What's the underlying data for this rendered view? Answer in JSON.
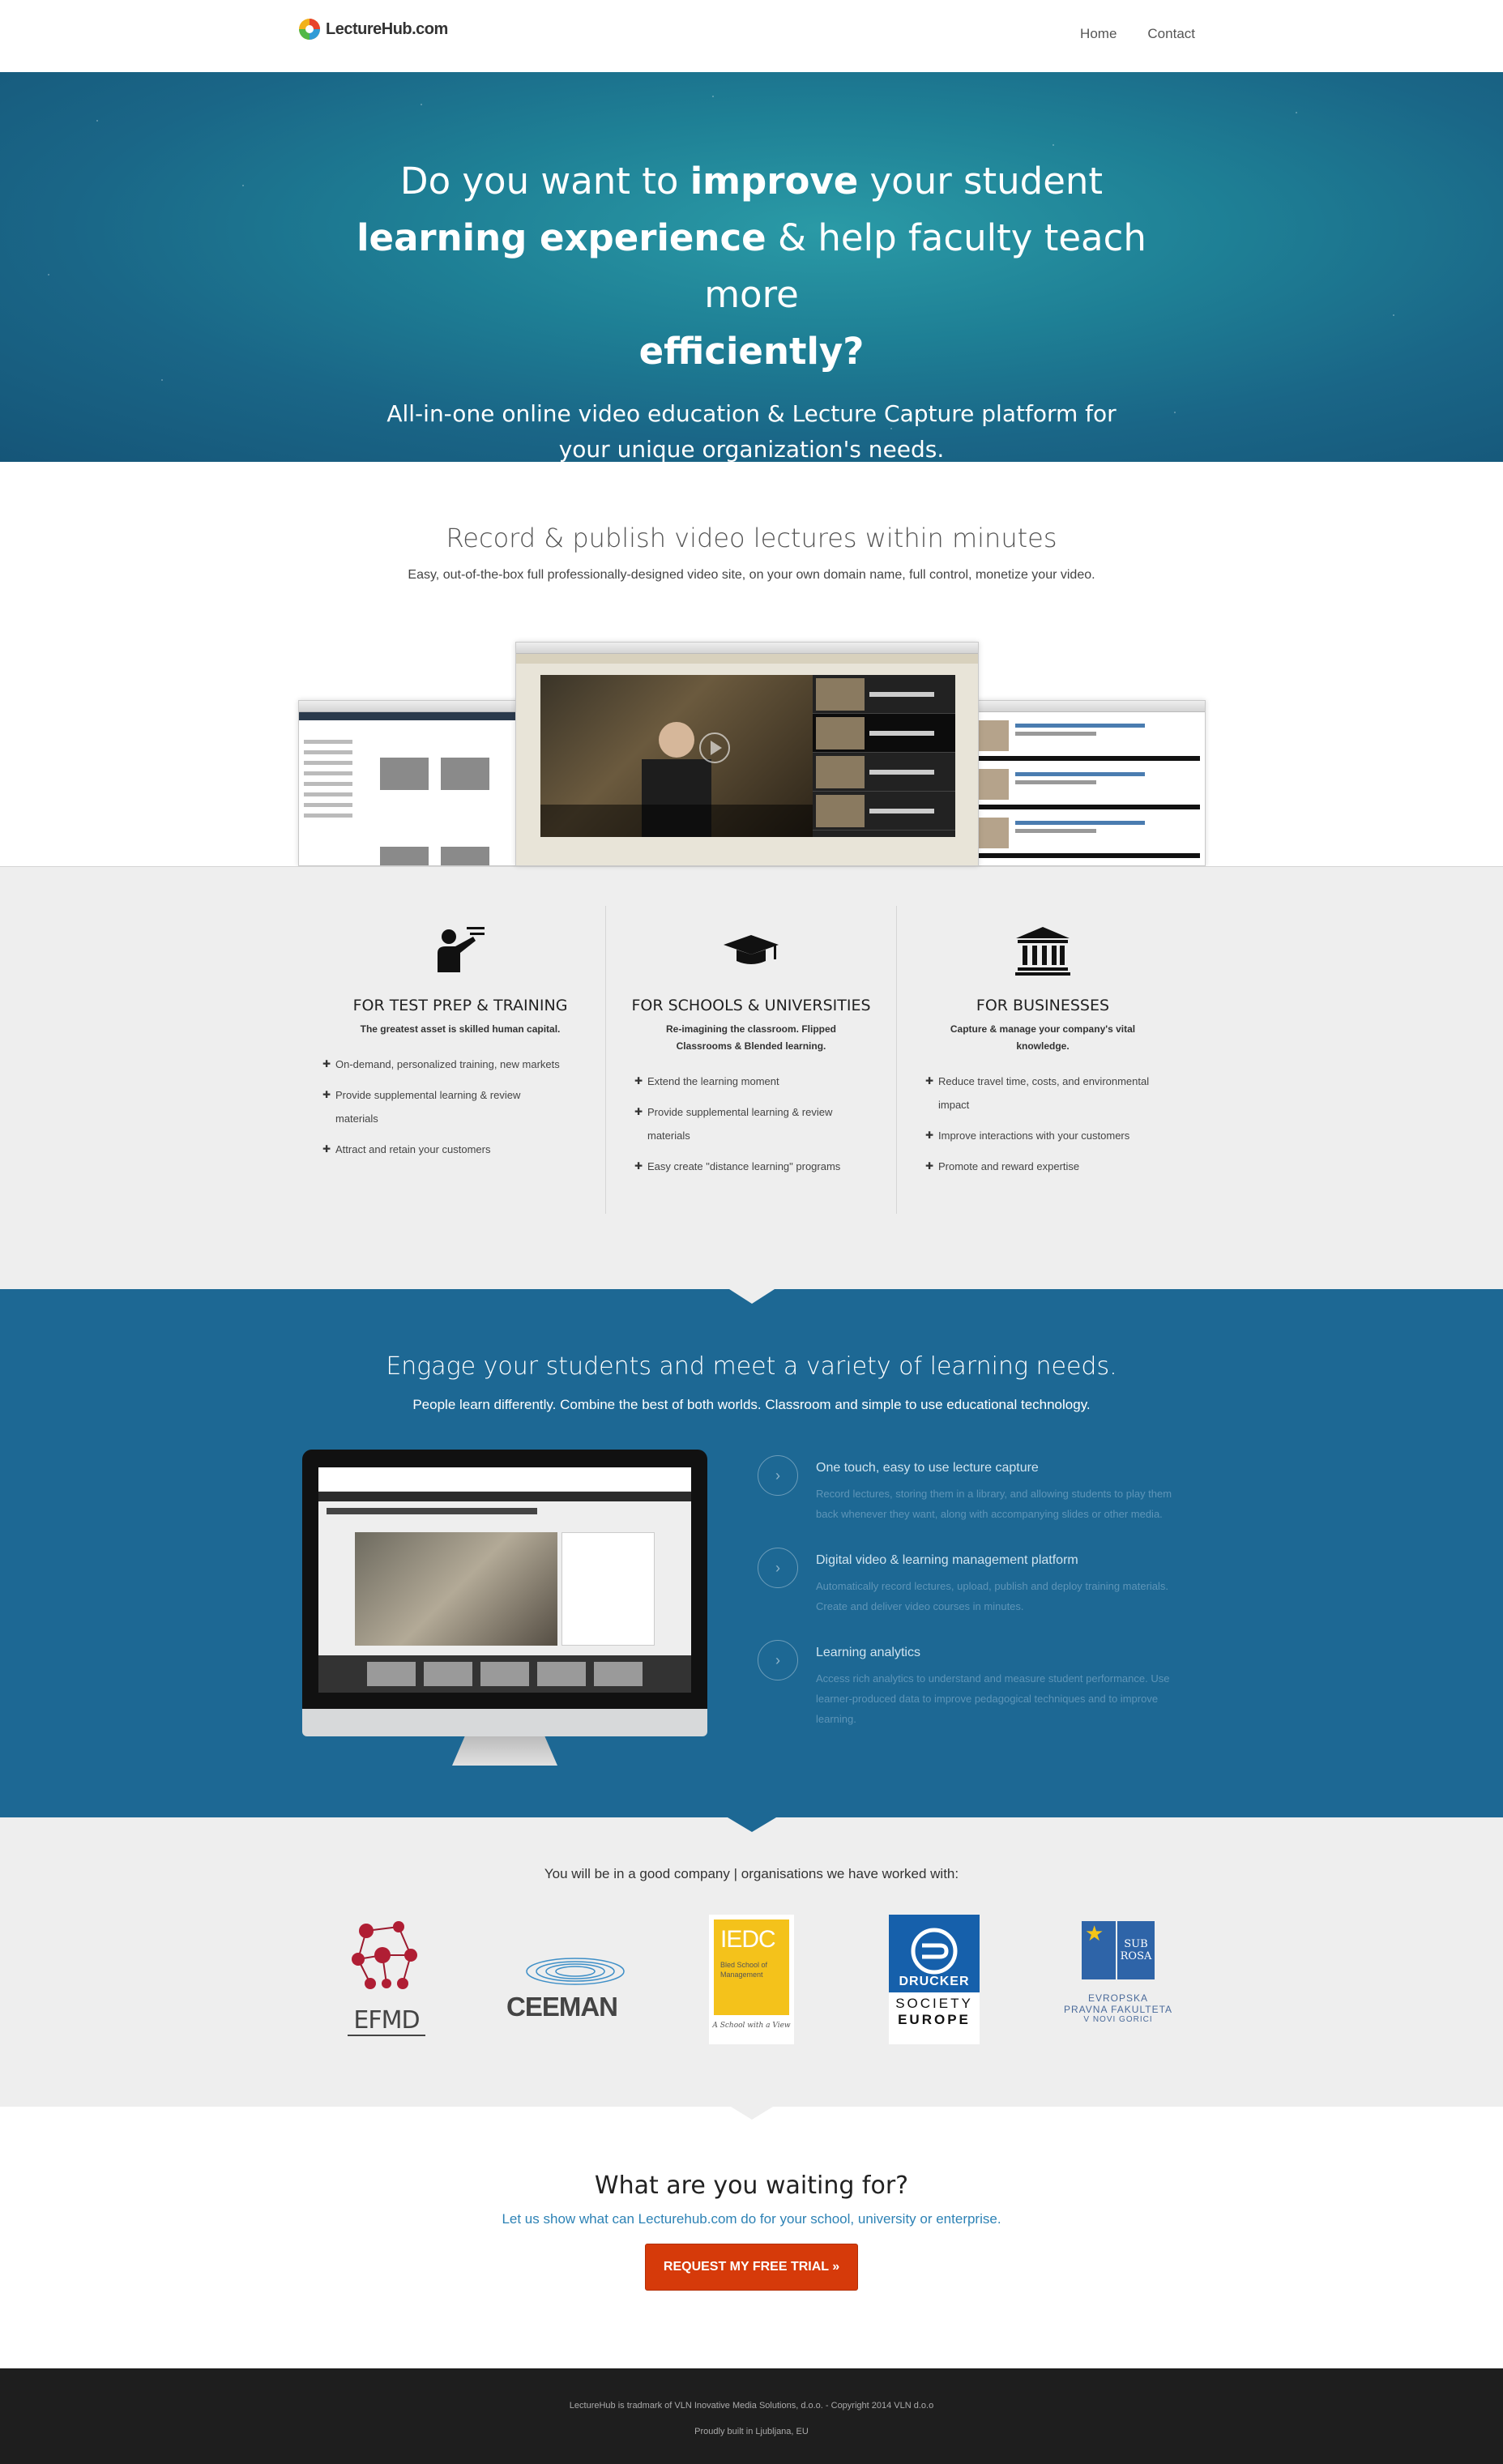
{
  "nav": {
    "logo_text": "LectureHub.com",
    "links": [
      "Home",
      "Contact"
    ]
  },
  "hero": {
    "line1_pre": "Do you want to ",
    "line1_bold": "improve",
    "line1_post": " your student",
    "line2_bold": "learning experience",
    "line2_post": " & help faculty teach more",
    "line3_bold": "efficiently?",
    "subtitle": "All-in-one online video education & Lecture Capture platform for your unique organization's needs."
  },
  "record": {
    "title": "Record & publish video lectures within minutes",
    "subtitle": "Easy, out-of-the-box full professionally-designed video site, on your own domain name, full control, monetize your video."
  },
  "features": [
    {
      "icon": "teacher-icon",
      "title": "FOR TEST PREP & TRAINING",
      "tagline": "The greatest asset is skilled human capital.",
      "items": [
        "On-demand, personalized training, new markets",
        "Provide supplemental learning & review materials",
        "Attract and retain your customers"
      ]
    },
    {
      "icon": "graduation-cap-icon",
      "title": "FOR SCHOOLS & UNIVERSITIES",
      "tagline": "Re-imagining the classroom. Flipped Classrooms & Blended learning.",
      "items": [
        "Extend the learning moment",
        "Provide supplemental learning & review materials",
        "Easy create \"distance learning\" programs"
      ]
    },
    {
      "icon": "institution-icon",
      "title": "FOR BUSINESSES",
      "tagline": "Capture & manage your company's vital knowledge.",
      "items": [
        "Reduce travel time, costs, and environmental impact",
        "Improve interactions with your customers",
        "Promote and reward expertise"
      ]
    }
  ],
  "engage": {
    "title": "Engage your students and meet a variety of learning needs.",
    "subtitle": "People learn differently. Combine the best of both worlds. Classroom and simple to use educational technology.",
    "items": [
      {
        "title": "One touch, easy to use lecture capture",
        "text": "Record lectures, storing them in a library, and allowing students to play them back whenever they want, along with accompanying slides or other media."
      },
      {
        "title": "Digital video & learning management platform",
        "text": "Automatically record lectures, upload, publish and deploy training materials. Create and deliver video courses in minutes."
      },
      {
        "title": "Learning analytics",
        "text": "Access rich analytics to understand and measure student performance. Use learner-produced data to improve pedagogical techniques and to improve learning."
      }
    ]
  },
  "partners": {
    "heading": "You will be in a good company | organisations we have worked with:",
    "logos": {
      "efmd": "EFMD",
      "ceeman": "CEEMAN",
      "iedc": "IEDC",
      "iedc_sub": "Bled School of Management",
      "iedc_tag": "A School with a View",
      "drucker_1": "DRUCKER",
      "drucker_2": "SOCIETY",
      "drucker_3": "EUROPE",
      "subrosa_1": "SUB",
      "subrosa_2": "ROSA",
      "epf_1": "EVROPSKA",
      "epf_2": "PRAVNA FAKULTETA",
      "epf_3": "V NOVI GORICI"
    }
  },
  "cta": {
    "title": "What are you waiting for?",
    "subtitle": "Let us show what can Lecturehub.com do for your school, university or enterprise.",
    "button": "REQUEST MY FREE TRIAL »"
  },
  "footer": {
    "line1": "LectureHub is tradmark of VLN Inovative Media Solutions, d.o.o. - Copyright 2014 VLN d.o.o",
    "line2": "Proudly built in Ljubljana, EU"
  },
  "colors": {
    "hero": "#1e7f95",
    "engage": "#1d6894",
    "cta_button": "#d63a0a",
    "footer": "#1e1e1e"
  }
}
